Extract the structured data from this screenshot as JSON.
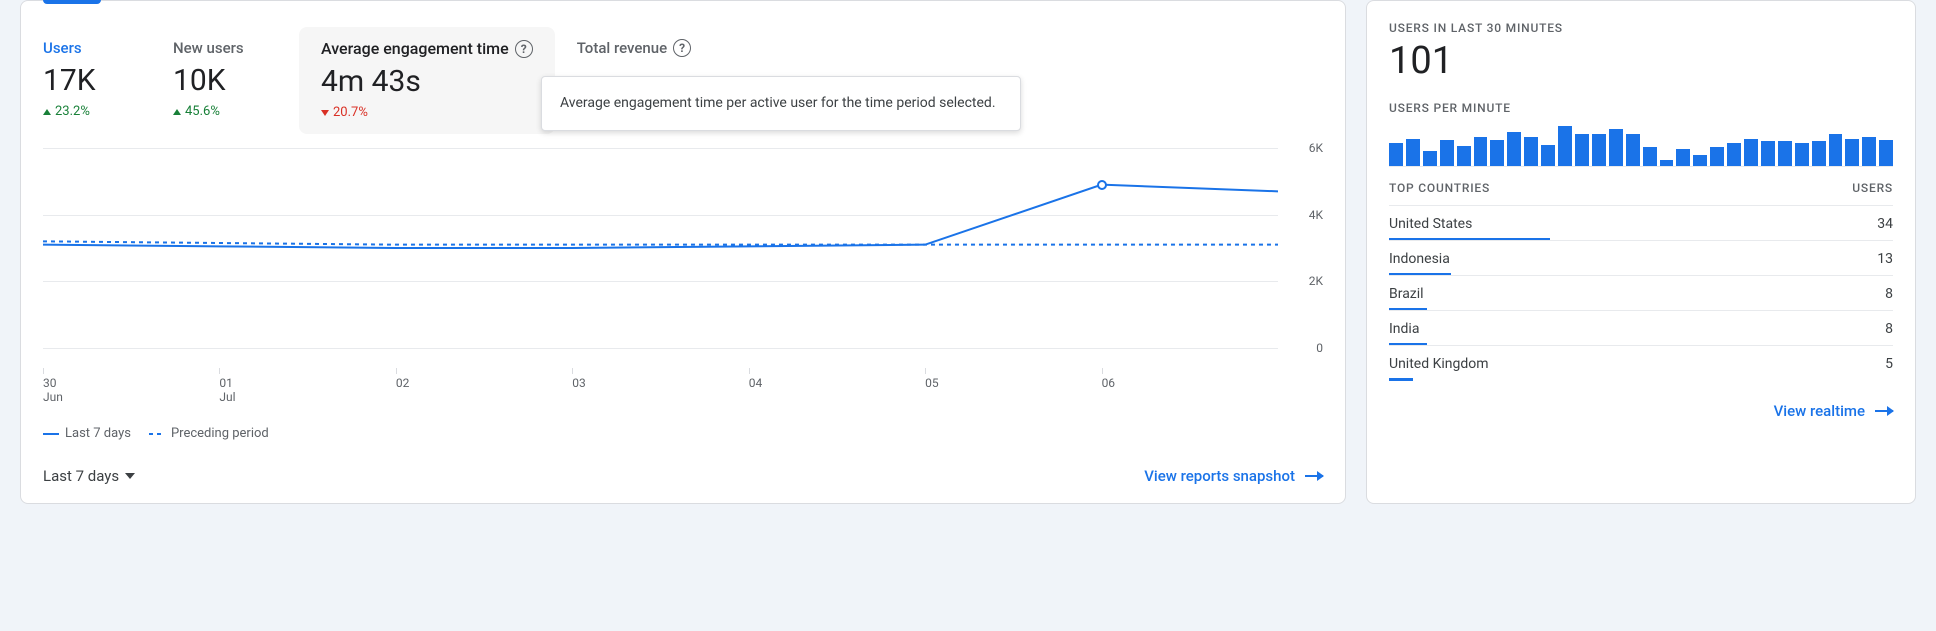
{
  "metrics": {
    "users": {
      "label": "Users",
      "value": "17K",
      "delta": "23.2%",
      "dir": "up"
    },
    "new_users": {
      "label": "New users",
      "value": "10K",
      "delta": "45.6%",
      "dir": "up"
    },
    "avg_engagement": {
      "label": "Average engagement time",
      "value": "4m 43s",
      "delta": "20.7%",
      "dir": "down"
    },
    "total_revenue": {
      "label": "Total revenue"
    }
  },
  "tooltip": "Average engagement time per active user for the time period selected.",
  "legend": {
    "current": "Last 7 days",
    "previous": "Preceding period"
  },
  "range_label": "Last 7 days",
  "footer_link_left": "View reports snapshot",
  "realtime": {
    "title": "USERS IN LAST 30 MINUTES",
    "value": "101",
    "per_minute_title": "USERS PER MINUTE",
    "countries_title": "TOP COUNTRIES",
    "users_col": "USERS",
    "link": "View realtime"
  },
  "chart_data": {
    "type": "line",
    "x_labels": [
      "30\nJun",
      "01\nJul",
      "02",
      "03",
      "04",
      "05",
      "06"
    ],
    "x_index": [
      0,
      1,
      2,
      3,
      4,
      5,
      6
    ],
    "series": [
      {
        "name": "Last 7 days",
        "style": "solid",
        "values": [
          3100,
          3050,
          3000,
          3000,
          3050,
          3100,
          4900,
          4700
        ]
      },
      {
        "name": "Preceding period",
        "style": "dashed",
        "values": [
          3200,
          3150,
          3100,
          3100,
          3100,
          3100,
          3100,
          3100
        ]
      }
    ],
    "ylabels": [
      "0",
      "2K",
      "4K",
      "6K"
    ],
    "ylim": [
      0,
      6000
    ],
    "marker": {
      "xi": 6,
      "y": 4900
    },
    "per_minute_bars": [
      22,
      26,
      14,
      25,
      19,
      28,
      25,
      32,
      28,
      20,
      38,
      30,
      30,
      35,
      30,
      18,
      6,
      16,
      10,
      18,
      22,
      26,
      24,
      24,
      22,
      24,
      30,
      26,
      28,
      25
    ],
    "countries": [
      {
        "name": "United States",
        "users": 34
      },
      {
        "name": "Indonesia",
        "users": 13
      },
      {
        "name": "Brazil",
        "users": 8
      },
      {
        "name": "India",
        "users": 8
      },
      {
        "name": "United Kingdom",
        "users": 5
      }
    ]
  }
}
